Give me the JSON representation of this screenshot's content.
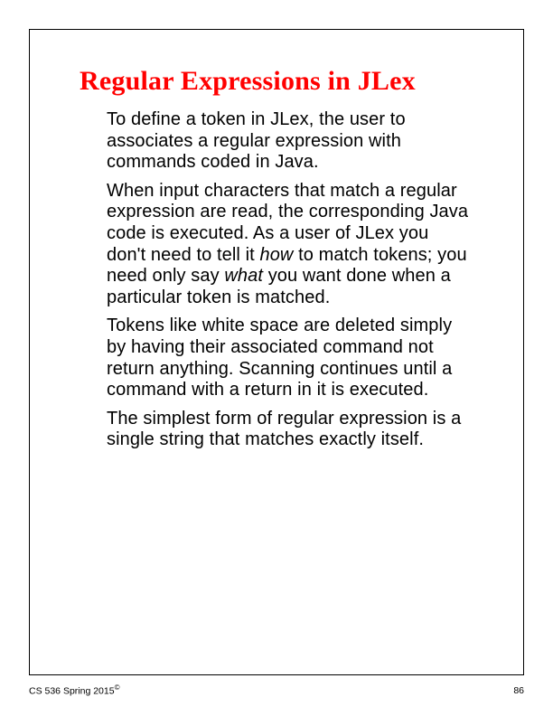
{
  "title": "Regular Expressions in JLex",
  "paragraphs": {
    "p1": "To define a token in JLex, the user to associates a regular expression with commands coded in Java.",
    "p2_a": "When input characters that match a regular expression are read, the corresponding Java code is executed. As a user of JLex you don't need to tell it ",
    "p2_how": "how",
    "p2_b": " to match tokens; you need only say ",
    "p2_what": "what",
    "p2_c": " you want done when a particular token is matched.",
    "p3": "Tokens like white space are deleted simply by having their associated command not return anything. Scanning continues until a command with a return in it is executed.",
    "p4": "The simplest form of regular expression is a single string that matches exactly itself."
  },
  "footer": {
    "course": "CS 536  Spring 2015",
    "mark": "©",
    "page": "86"
  }
}
